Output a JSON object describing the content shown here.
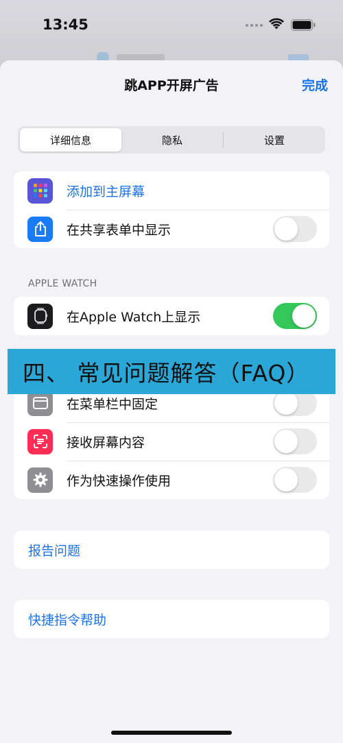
{
  "status_bar": {
    "time": "13:45"
  },
  "sheet": {
    "title": "跳APP开屏广告",
    "done_label": "完成"
  },
  "segments": [
    {
      "label": "详细信息",
      "selected": true
    },
    {
      "label": "隐私",
      "selected": false
    },
    {
      "label": "设置",
      "selected": false
    }
  ],
  "group1": [
    {
      "label": "添加到主屏幕",
      "icon": "app-grid-icon",
      "icon_color": "#5856d6"
    },
    {
      "label": "在共享表单中显示",
      "icon": "share-icon",
      "icon_color": "#1a7cf5",
      "toggle": false
    }
  ],
  "apple_watch": {
    "header": "APPLE WATCH",
    "label": "在Apple Watch上显示",
    "icon": "watch-icon",
    "icon_color": "#1c1c1e",
    "toggle": true
  },
  "group3": [
    {
      "label": "在菜单栏中固定",
      "icon": "window-icon",
      "icon_color": "#8e8e93",
      "toggle": false
    },
    {
      "label": "接收屏幕内容",
      "icon": "screen-capture-icon",
      "icon_color": "#ff2d55",
      "toggle": false
    },
    {
      "label": "作为快速操作使用",
      "icon": "gear-icon",
      "icon_color": "#8e8e93",
      "toggle": false
    }
  ],
  "links": {
    "report_issue": "报告问题",
    "shortcuts_help": "快捷指令帮助"
  },
  "overlay": {
    "text": "四、 常见问题解答（FAQ）",
    "color": "#2aa7d6"
  },
  "colors": {
    "accent": "#1a73e8",
    "toggle_on": "#34c759",
    "background": "#f2f2f7"
  }
}
